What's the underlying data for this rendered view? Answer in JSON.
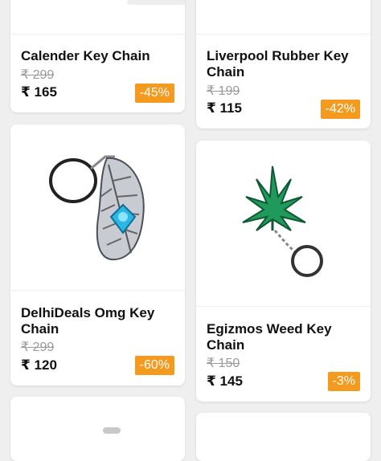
{
  "products": [
    {
      "title": "Calender Key Chain",
      "mrp": "₹ 299",
      "price": "₹ 165",
      "discount": "-45%"
    },
    {
      "title": "Liverpool Rubber Key Chain",
      "mrp": "₹ 199",
      "price": "₹ 115",
      "discount": "-42%"
    },
    {
      "title": "DelhiDeals Omg Key Chain",
      "mrp": "₹ 299",
      "price": "₹ 120",
      "discount": "-60%"
    },
    {
      "title": "Egizmos Weed Key Chain",
      "mrp": "₹ 150",
      "price": "₹ 145",
      "discount": "-3%"
    }
  ],
  "colors": {
    "badge": "#f39a1f",
    "background": "#efefef",
    "card": "#ffffff",
    "leaf": "#1f9a5b"
  }
}
